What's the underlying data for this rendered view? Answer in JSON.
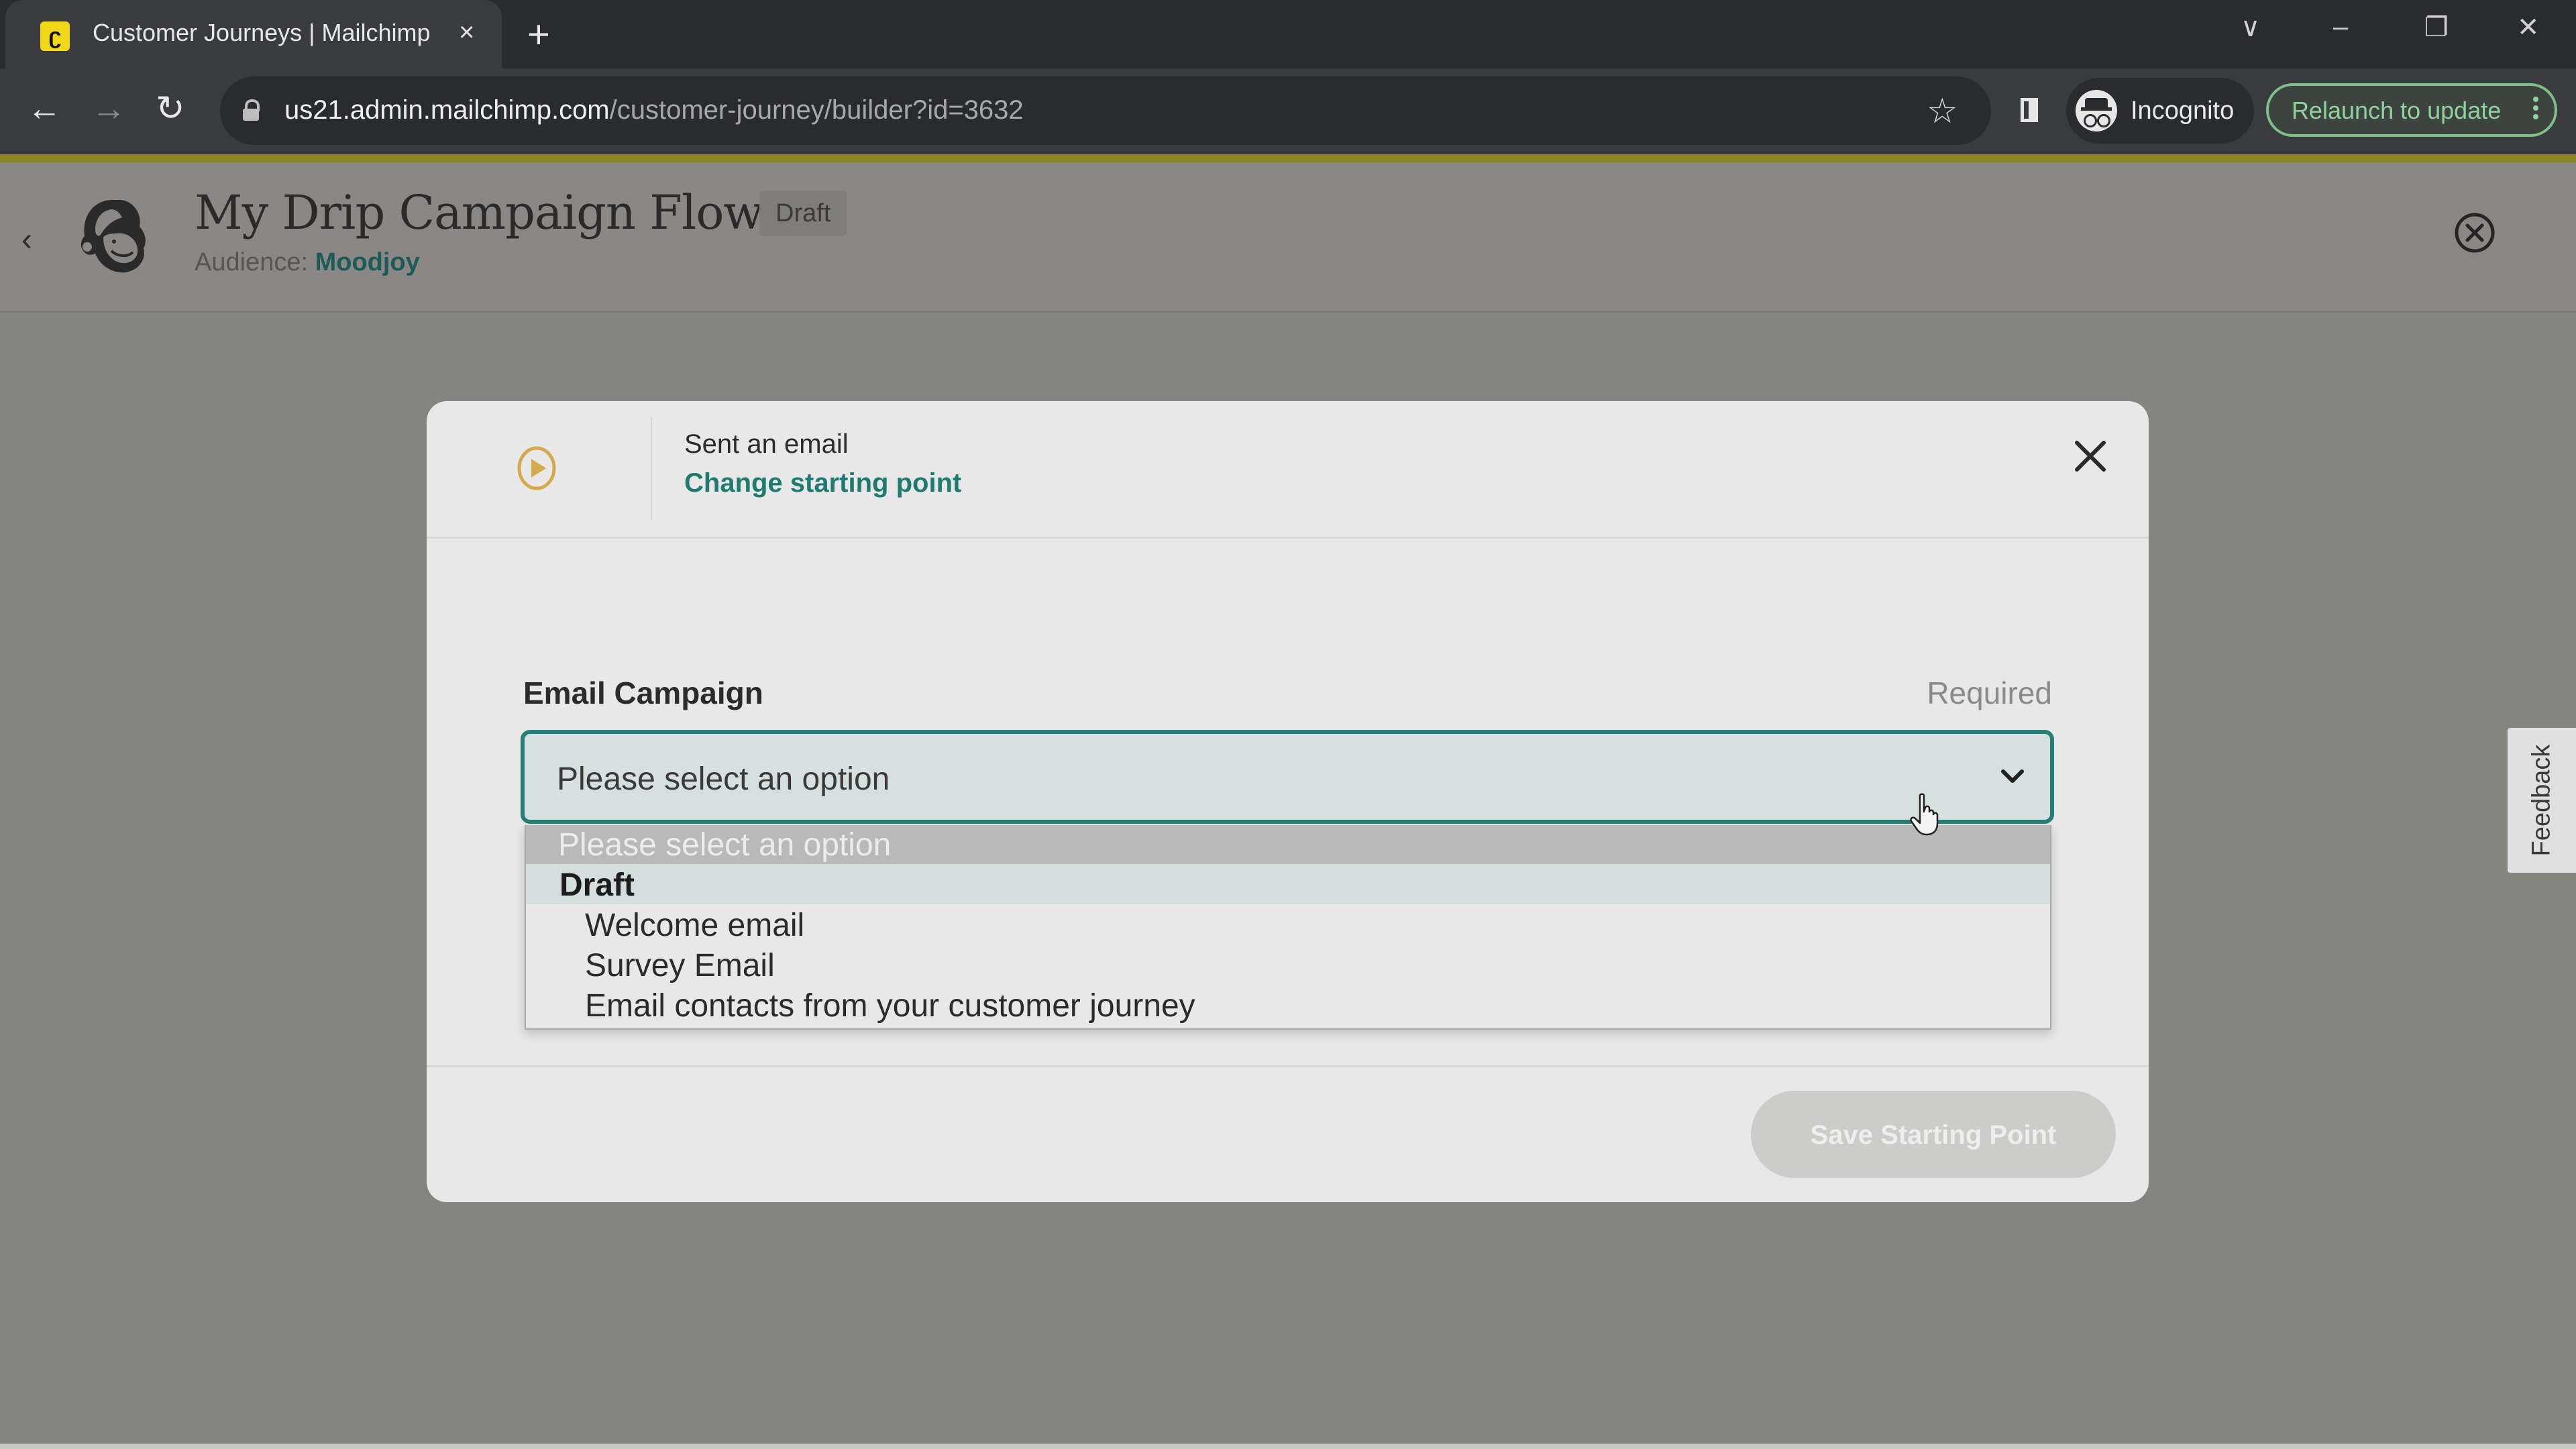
{
  "browser": {
    "tab": {
      "title": "Customer Journeys | Mailchimp",
      "favicon": "mailchimp-logo-icon",
      "close_glyph": "×"
    },
    "new_tab_glyph": "+",
    "window_controls": {
      "tab_search_glyph": "∨",
      "minimize_glyph": "–",
      "restore_glyph": "❐",
      "close_glyph": "✕"
    },
    "nav": {
      "back_glyph": "←",
      "forward_glyph": "→",
      "reload_glyph": "↻"
    },
    "url": {
      "host": "us21.admin.mailchimp.com",
      "path": "/customer-journey/builder?id=3632"
    },
    "bookmark_glyph": "☆",
    "profile_label": "Incognito",
    "relaunch_label": "Relaunch to update",
    "colors": {
      "relaunch_accent": "#8fd39c",
      "accent_line": "#8a8625"
    }
  },
  "header": {
    "back_glyph": "‹",
    "title": "My Drip Campaign Flow",
    "status_badge": "Draft",
    "audience_label": "Audience:",
    "audience_name": "Moodjoy"
  },
  "modal": {
    "trigger_title": "Sent an email",
    "change_link": "Change starting point",
    "field": {
      "label": "Email Campaign",
      "required_label": "Required",
      "selected_value": "Please select an option"
    },
    "dropdown": {
      "placeholder_option": "Please select an option",
      "groups": [
        {
          "label": "Draft",
          "options": [
            "Welcome email",
            "Survey Email",
            "Email contacts from your customer journey"
          ]
        }
      ]
    },
    "save_button": "Save Starting Point",
    "colors": {
      "link": "#1f7a70",
      "focus_border": "#257f74",
      "play_icon": "#d4aa4a"
    }
  },
  "feedback_tab": {
    "label": "Feedback"
  }
}
